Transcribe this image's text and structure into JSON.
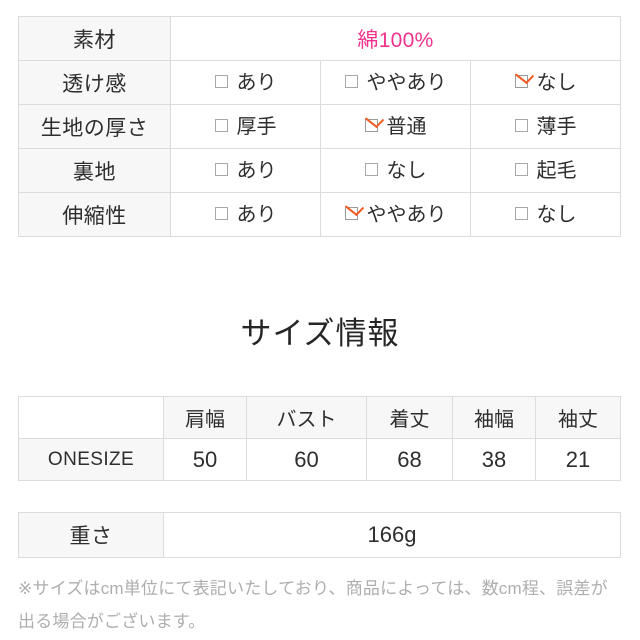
{
  "material_spec_table": {
    "material_row": {
      "label": "素材",
      "value": "綿100%",
      "value_color": "#f0328c"
    },
    "option_rows": [
      {
        "label": "透け感",
        "options": [
          {
            "label": "あり",
            "checked": false
          },
          {
            "label": "ややあり",
            "checked": false
          },
          {
            "label": "なし",
            "checked": true
          }
        ]
      },
      {
        "label": "生地の厚さ",
        "options": [
          {
            "label": "厚手",
            "checked": false
          },
          {
            "label": "普通",
            "checked": true
          },
          {
            "label": "薄手",
            "checked": false
          }
        ]
      },
      {
        "label": "裏地",
        "options": [
          {
            "label": "あり",
            "checked": false
          },
          {
            "label": "なし",
            "checked": false
          },
          {
            "label": "起毛",
            "checked": false
          }
        ]
      },
      {
        "label": "伸縮性",
        "options": [
          {
            "label": "あり",
            "checked": false
          },
          {
            "label": "ややあり",
            "checked": true
          },
          {
            "label": "なし",
            "checked": false
          }
        ]
      }
    ]
  },
  "size_section": {
    "heading": "サイズ情報",
    "corner_label": "",
    "columns": [
      "肩幅",
      "バスト",
      "着丈",
      "袖幅",
      "袖丈"
    ],
    "rows": [
      {
        "label": "ONESIZE",
        "values": [
          "50",
          "60",
          "68",
          "38",
          "21"
        ]
      }
    ]
  },
  "weight_table": {
    "label": "重さ",
    "value": "166g"
  },
  "note": {
    "text": "※サイズはcm単位にて表記いたしており、商品によっては、数cm程、誤差が出る場合がございます。"
  },
  "colors": {
    "accent_check": "#f15a22",
    "material_pink": "#f0328c",
    "border": "#dcdcdc",
    "header_fill": "#f7f7f7",
    "note_text": "#aeaeae"
  }
}
